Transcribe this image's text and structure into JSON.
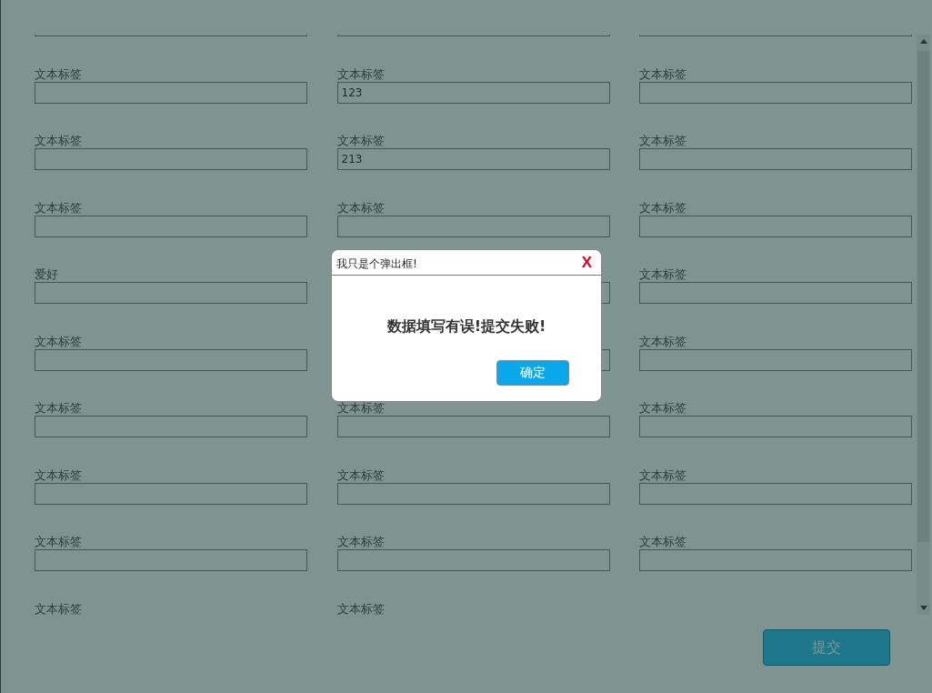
{
  "form": {
    "rows": [
      {
        "fields": [
          {
            "kind": "input_only"
          },
          {
            "kind": "input_only"
          },
          {
            "kind": "input_only"
          }
        ]
      },
      {
        "fields": [
          {
            "kind": "labeled_input",
            "label": "文本标签"
          },
          {
            "kind": "labeled_input",
            "label": "文本标签",
            "value": "123"
          },
          {
            "kind": "labeled_input",
            "label": "文本标签"
          }
        ]
      },
      {
        "fields": [
          {
            "kind": "labeled_input",
            "label": "文本标签"
          },
          {
            "kind": "labeled_input",
            "label": "文本标签",
            "value": "213"
          },
          {
            "kind": "labeled_input",
            "label": "文本标签"
          }
        ]
      },
      {
        "fields": [
          {
            "kind": "labeled_input",
            "label": "文本标签"
          },
          {
            "kind": "labeled_input",
            "label": "文本标签"
          },
          {
            "kind": "labeled_input",
            "label": "文本标签"
          }
        ]
      },
      {
        "fields": [
          {
            "kind": "labeled_input",
            "label": "爱好"
          },
          {
            "kind": "input_only"
          },
          {
            "kind": "labeled_input",
            "label": "文本标签"
          }
        ]
      },
      {
        "fields": [
          {
            "kind": "labeled_input",
            "label": "文本标签"
          },
          {
            "kind": "input_only"
          },
          {
            "kind": "labeled_input",
            "label": "文本标签"
          }
        ]
      },
      {
        "fields": [
          {
            "kind": "labeled_input",
            "label": "文本标签"
          },
          {
            "kind": "labeled_input",
            "label": "文本标签"
          },
          {
            "kind": "labeled_input",
            "label": "文本标签"
          }
        ]
      },
      {
        "fields": [
          {
            "kind": "labeled_input",
            "label": "文本标签"
          },
          {
            "kind": "labeled_input",
            "label": "文本标签"
          },
          {
            "kind": "labeled_input",
            "label": "文本标签"
          }
        ]
      },
      {
        "fields": [
          {
            "kind": "labeled_input",
            "label": "文本标签"
          },
          {
            "kind": "labeled_input",
            "label": "文本标签"
          },
          {
            "kind": "labeled_input",
            "label": "文本标签"
          }
        ]
      },
      {
        "fields": [
          {
            "kind": "label_only",
            "label": "文本标签"
          },
          {
            "kind": "label_only",
            "label": "文本标签"
          }
        ]
      }
    ]
  },
  "submit_button": "提交",
  "dialog": {
    "title": "我只是个弹出框!",
    "close": "X",
    "message": "数据填写有误!提交失败!",
    "ok_button": "确定"
  }
}
